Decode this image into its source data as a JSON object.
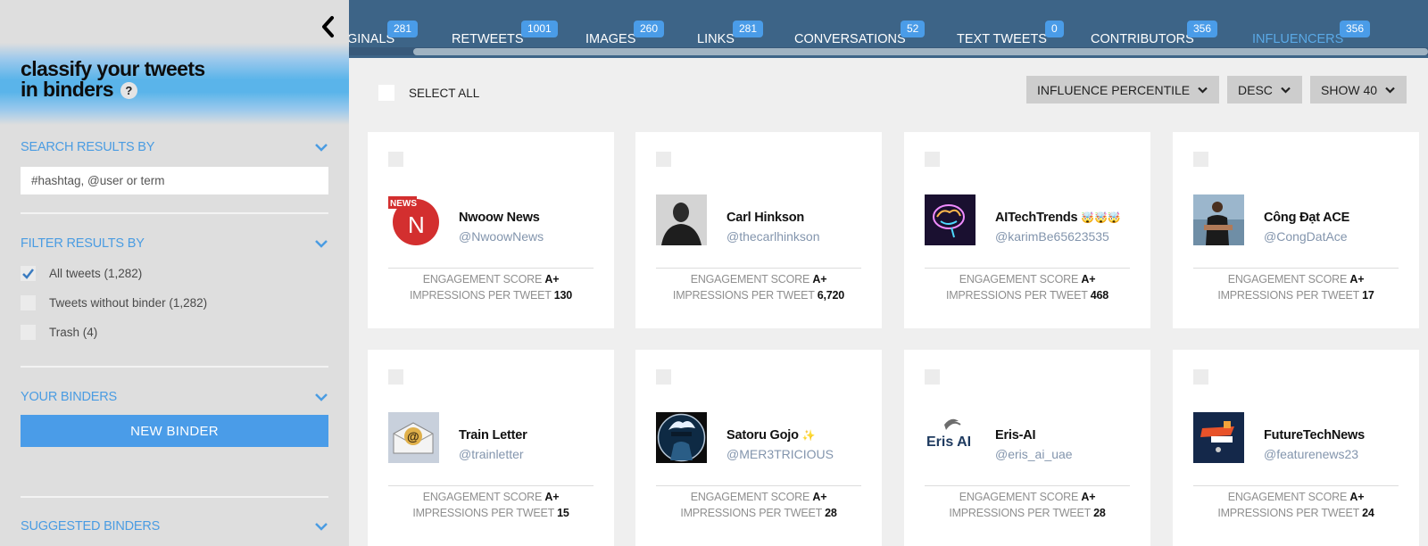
{
  "sidebar": {
    "title_line1": "classify your tweets",
    "title_line2": "in binders",
    "help": "?",
    "search_header": "SEARCH RESULTS BY",
    "search_placeholder": "#hashtag, @user or term",
    "search_value": "",
    "filter_header": "FILTER RESULTS BY",
    "filters": [
      {
        "label": "All tweets (1,282)",
        "checked": true
      },
      {
        "label": "Tweets without binder (1,282)",
        "checked": false
      },
      {
        "label": "Trash (4)",
        "checked": false
      }
    ],
    "binders_header": "YOUR BINDERS",
    "new_binder": "NEW BINDER",
    "suggested_header": "SUGGESTED BINDERS"
  },
  "tabs": [
    {
      "label": "ORIGINALS",
      "visible_label": "GINALS",
      "count": "281",
      "active": false
    },
    {
      "label": "RETWEETS",
      "count": "1001",
      "active": false
    },
    {
      "label": "IMAGES",
      "count": "260",
      "active": false
    },
    {
      "label": "LINKS",
      "count": "281",
      "active": false
    },
    {
      "label": "CONVERSATIONS",
      "count": "52",
      "active": false
    },
    {
      "label": "TEXT TWEETS",
      "count": "0",
      "active": false
    },
    {
      "label": "CONTRIBUTORS",
      "count": "356",
      "active": false
    },
    {
      "label": "INFLUENCERS",
      "count": "356",
      "active": true
    }
  ],
  "toolbar": {
    "select_all": "SELECT ALL",
    "sort_by": "INFLUENCE PERCENTILE",
    "order": "DESC",
    "show": "SHOW 40"
  },
  "colors": {
    "accent": "#4a9ce8",
    "tabbar": "#3d6487",
    "active_tab": "#5aa9e6",
    "handle": "#8395ad"
  },
  "cards": [
    {
      "name": "Nwoow News",
      "handle": "@NwoowNews",
      "engagement_label": "ENGAGEMENT SCORE",
      "engagement": "A+",
      "impressions_label": "IMPRESSIONS PER TWEET",
      "impressions": "130",
      "avatar": "news-logo"
    },
    {
      "name": "Carl Hinkson",
      "handle": "@thecarlhinkson",
      "engagement_label": "ENGAGEMENT SCORE",
      "engagement": "A+",
      "impressions_label": "IMPRESSIONS PER TWEET",
      "impressions": "6,720",
      "avatar": "portrait-photo"
    },
    {
      "name": "AITechTrends",
      "name_suffix": "🤯🤯🤯",
      "handle": "@karimBe65623535",
      "engagement_label": "ENGAGEMENT SCORE",
      "engagement": "A+",
      "impressions_label": "IMPRESSIONS PER TWEET",
      "impressions": "468",
      "avatar": "neon-brain"
    },
    {
      "name": "Công Đạt ACE",
      "handle": "@CongDatAce",
      "engagement_label": "ENGAGEMENT SCORE",
      "engagement": "A+",
      "impressions_label": "IMPRESSIONS PER TWEET",
      "impressions": "17",
      "avatar": "beach-photo"
    },
    {
      "name": "Train Letter",
      "handle": "@trainletter",
      "engagement_label": "ENGAGEMENT SCORE",
      "engagement": "A+",
      "impressions_label": "IMPRESSIONS PER TWEET",
      "impressions": "15",
      "avatar": "envelope-at"
    },
    {
      "name": "Satoru Gojo",
      "name_suffix": "✨",
      "handle": "@MER3TRICIOUS",
      "engagement_label": "ENGAGEMENT SCORE",
      "engagement": "A+",
      "impressions_label": "IMPRESSIONS PER TWEET",
      "impressions": "28",
      "avatar": "anime-portrait"
    },
    {
      "name": "Eris-AI",
      "handle": "@eris_ai_uae",
      "engagement_label": "ENGAGEMENT SCORE",
      "engagement": "A+",
      "impressions_label": "IMPRESSIONS PER TWEET",
      "impressions": "28",
      "avatar": "eris-ai-logo",
      "avatar_text": "Eris AI"
    },
    {
      "name": "FutureTechNews",
      "handle": "@featurenews23",
      "engagement_label": "ENGAGEMENT SCORE",
      "engagement": "A+",
      "impressions_label": "IMPRESSIONS PER TWEET",
      "impressions": "24",
      "avatar": "future-tech-logo"
    }
  ]
}
